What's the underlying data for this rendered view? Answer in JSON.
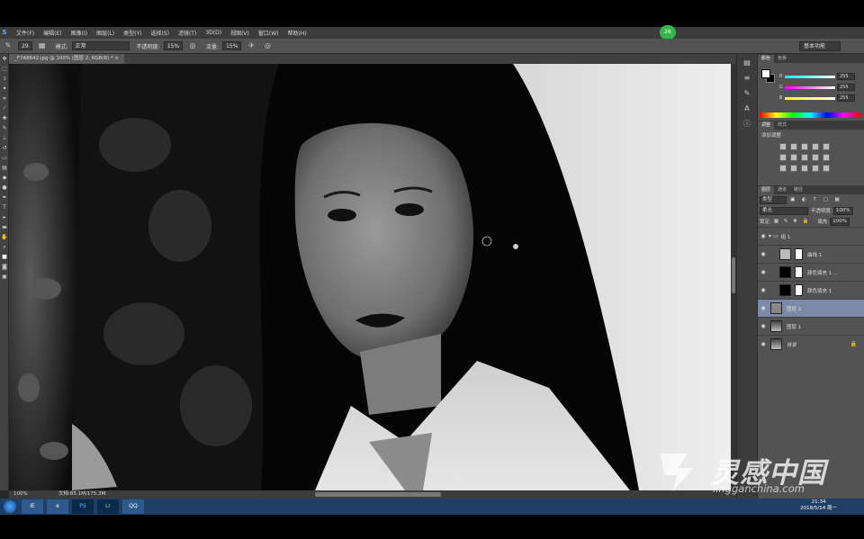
{
  "app": {
    "logo": "Ps"
  },
  "menubar": {
    "logo_text": "S",
    "items": [
      "文件(F)",
      "编辑(E)",
      "图像(I)",
      "图层(L)",
      "类型(Y)",
      "选择(S)",
      "滤镜(T)",
      "3D(D)",
      "视图(V)",
      "窗口(W)",
      "帮助(H)"
    ],
    "badge": "26"
  },
  "options": {
    "brush_size": "29",
    "mode_label": "模式:",
    "mode_value": "正常",
    "opacity_label": "不透明度:",
    "opacity_value": "15%",
    "flow_label": "流量:",
    "flow_value": "15%",
    "workspace": "基本功能"
  },
  "document": {
    "tab_title": "_F7A8642.jpg @ 100% (图层 2, RGB/8) *",
    "zoom": "100%",
    "doc_size": "文档:85.1M/175.3M"
  },
  "panels": {
    "color": {
      "tabs": [
        "颜色",
        "色板"
      ],
      "channels": [
        {
          "name": "R",
          "value": "255"
        },
        {
          "name": "G",
          "value": "255"
        },
        {
          "name": "B",
          "value": "255"
        }
      ]
    },
    "adjustments": {
      "tabs": [
        "调整",
        "样式"
      ],
      "title": "添加调整"
    },
    "layers": {
      "tabs": [
        "图层",
        "通道",
        "路径"
      ],
      "filter": "类型",
      "blend_mode": "柔光",
      "opacity_label": "不透明度:",
      "opacity_value": "100%",
      "lock_label": "锁定:",
      "fill_label": "填充:",
      "fill_value": "100%",
      "items": [
        {
          "name": "组 1",
          "kind": "group"
        },
        {
          "name": "曲线 1",
          "kind": "adjustment"
        },
        {
          "name": "颜色填充 1 ...",
          "kind": "fill"
        },
        {
          "name": "颜色填充 1",
          "kind": "fill"
        },
        {
          "name": "图层 2",
          "kind": "pixel",
          "selected": true
        },
        {
          "name": "图层 1",
          "kind": "photo"
        },
        {
          "name": "背景",
          "kind": "photo",
          "locked": true
        }
      ]
    }
  },
  "taskbar": {
    "items": [
      "IE",
      "e",
      "PS",
      "Lr",
      "QQ"
    ],
    "time": "21:34",
    "date": "2018/5/14 周一"
  },
  "watermark": {
    "cn": "灵感中国",
    "en": "lingganchina.com"
  },
  "colors": {
    "selected_layer": "#7b8aa6",
    "taskbar": "#1f3f66",
    "panel_bg": "#535353"
  }
}
